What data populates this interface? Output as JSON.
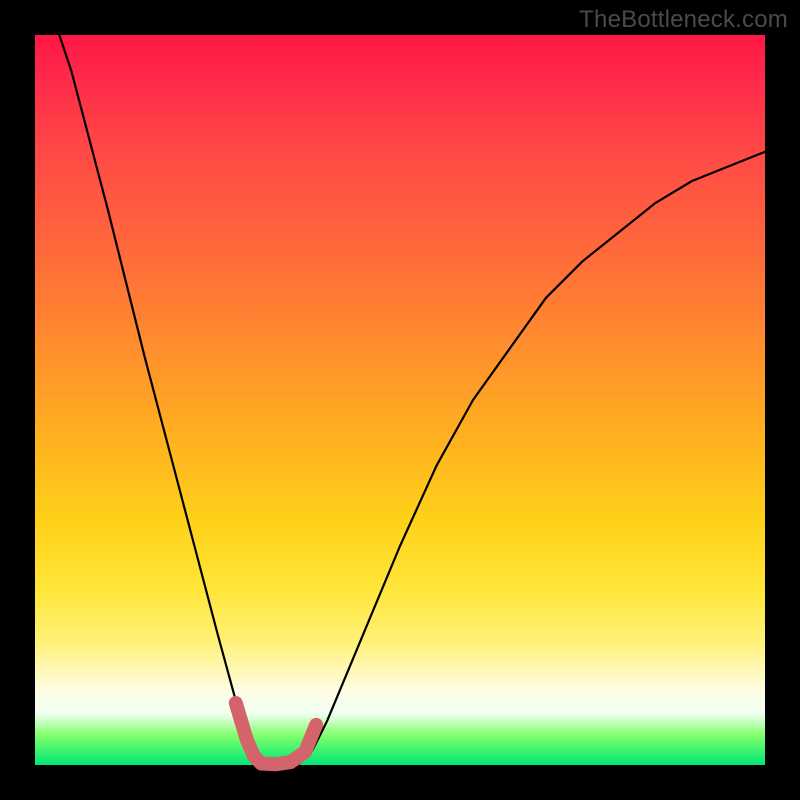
{
  "watermark": "TheBottleneck.com",
  "chart_data": {
    "type": "line",
    "title": "",
    "xlabel": "",
    "ylabel": "",
    "xlim": [
      0,
      1
    ],
    "ylim": [
      0,
      1
    ],
    "series": [
      {
        "name": "bottleneck-curve",
        "x": [
          0.0,
          0.05,
          0.1,
          0.15,
          0.2,
          0.25,
          0.28,
          0.3,
          0.32,
          0.34,
          0.36,
          0.38,
          0.4,
          0.45,
          0.5,
          0.55,
          0.6,
          0.65,
          0.7,
          0.75,
          0.8,
          0.85,
          0.9,
          0.95,
          1.0
        ],
        "values": [
          1.1,
          0.95,
          0.76,
          0.56,
          0.37,
          0.18,
          0.07,
          0.02,
          0.0,
          0.0,
          0.0,
          0.02,
          0.06,
          0.18,
          0.3,
          0.41,
          0.5,
          0.57,
          0.64,
          0.69,
          0.73,
          0.77,
          0.8,
          0.82,
          0.84
        ]
      },
      {
        "name": "highlight-segment",
        "x": [
          0.275,
          0.29,
          0.3,
          0.31,
          0.33,
          0.35,
          0.37,
          0.385
        ],
        "values": [
          0.085,
          0.035,
          0.012,
          0.002,
          0.001,
          0.004,
          0.018,
          0.055
        ]
      }
    ],
    "colors": {
      "curve": "#000000",
      "highlight": "#d4646b",
      "gradient_top": "#ff1744",
      "gradient_mid": "#ffd21a",
      "gradient_bottom": "#00e676"
    }
  }
}
